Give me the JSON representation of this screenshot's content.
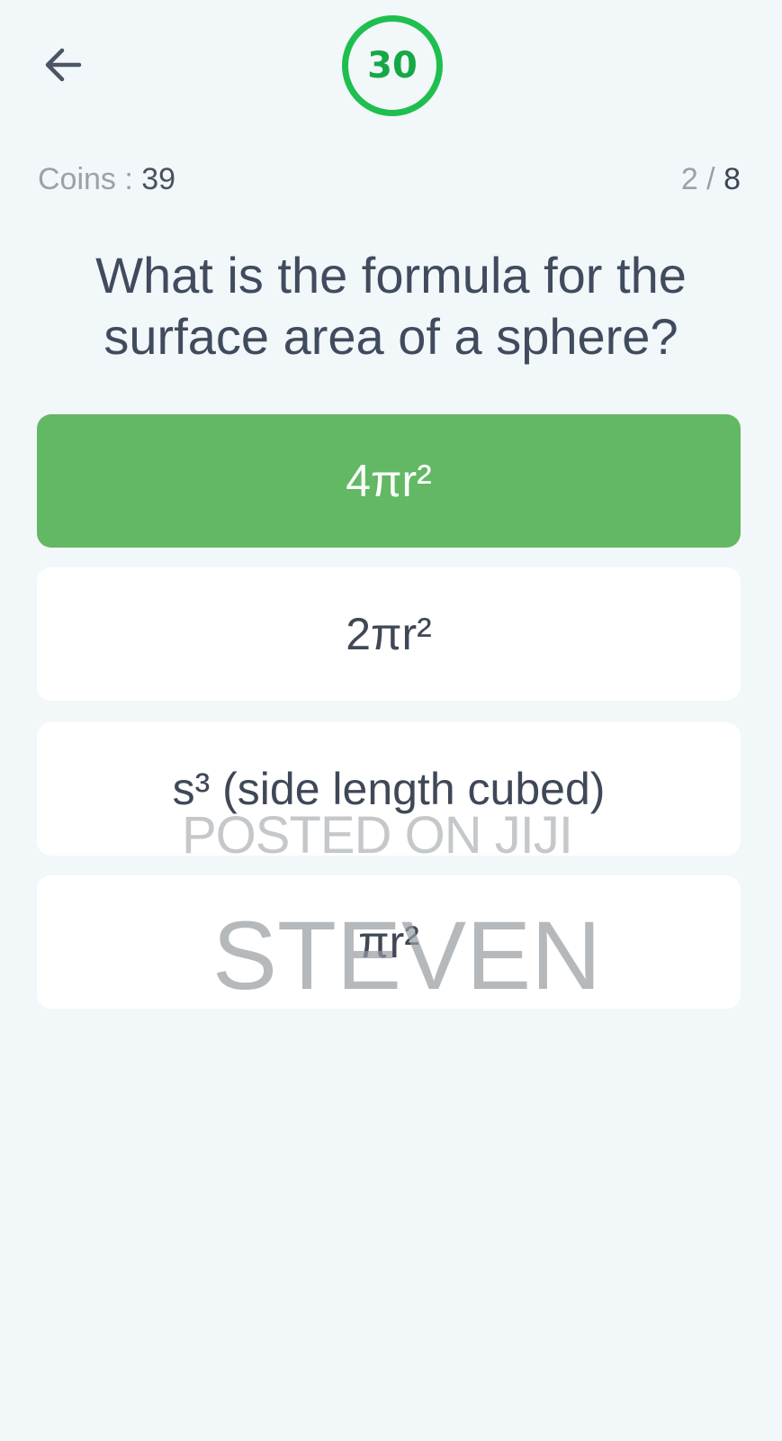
{
  "header": {
    "back_icon": "arrow-left-icon",
    "timer_value": "30"
  },
  "status": {
    "coins_label": "Coins : ",
    "coins_value": "39",
    "progress_current": "2",
    "progress_separator": " / ",
    "progress_total": "8"
  },
  "quiz": {
    "question": "What is the formula for the surface area of a sphere?",
    "options": [
      {
        "label": "4πr²",
        "selected": true
      },
      {
        "label": "2πr²",
        "selected": false
      },
      {
        "label": "s³ (side length cubed)",
        "selected": false
      },
      {
        "label": "πr²",
        "selected": false
      }
    ]
  },
  "watermark": {
    "line1": "POSTED ON JIJI",
    "line2": "STEVEN"
  },
  "colors": {
    "background": "#f2f7fa",
    "timer_ring": "#1fbf4f",
    "selected_option": "#63b863",
    "text_dark": "#404b5e",
    "text_muted": "#9aa1a9"
  }
}
